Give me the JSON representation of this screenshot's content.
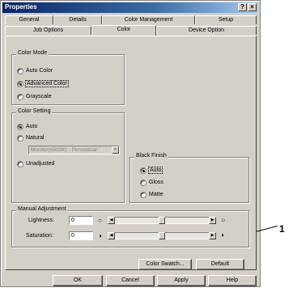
{
  "window": {
    "title": "Properties",
    "help_label": "?",
    "close_label": "×"
  },
  "tabs": {
    "row1": [
      "General",
      "Details",
      "Color Management",
      "Setup"
    ],
    "row2": [
      "Job Options",
      "Color",
      "Device Option"
    ],
    "active": "Color"
  },
  "color_mode": {
    "legend": "Color Mode",
    "options": [
      "Auto Color",
      "Advanced Color",
      "Grayscale"
    ],
    "selected": "Advanced Color"
  },
  "color_setting": {
    "legend": "Color Setting",
    "options": [
      "Auto",
      "Natural",
      "Unadjusted"
    ],
    "selected": "Auto",
    "monitor_combo": "Monitor(6500K) - Perceptual"
  },
  "black_finish": {
    "legend": "Black Finish",
    "options": [
      "Auto",
      "Gloss",
      "Matte"
    ],
    "selected": "Auto"
  },
  "manual_adjustment": {
    "legend": "Manual Adjustment",
    "lightness_label": "Lightness:",
    "lightness_value": "0",
    "saturation_label": "Saturation:",
    "saturation_value": "0",
    "lightness_slider_level": 0.5,
    "saturation_slider_level": 0.5
  },
  "panel_buttons": {
    "color_swatch": "Color Swatch...",
    "default": "Default"
  },
  "footer_buttons": {
    "ok": "OK",
    "cancel": "Cancel",
    "apply": "Apply",
    "help": "Help"
  },
  "callout": {
    "number": "1"
  },
  "icons": {
    "lightness_low": "○",
    "lightness_high": "☼",
    "saturation_low": "◑",
    "saturation_high": "◑"
  }
}
